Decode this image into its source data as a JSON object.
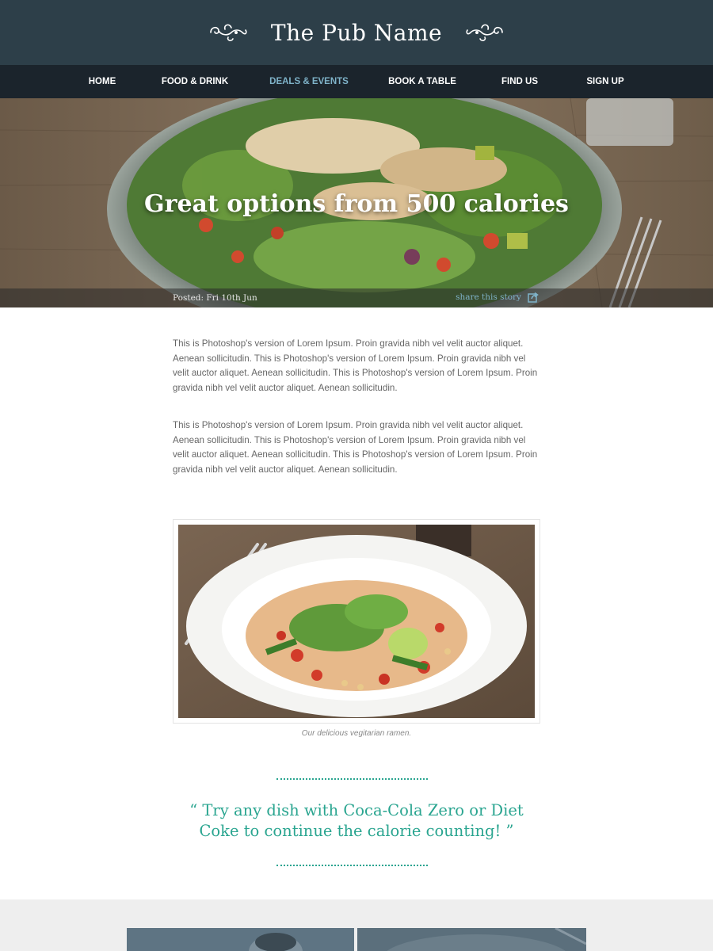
{
  "header": {
    "brand_title": "The Pub Name",
    "background_color": "#2d3f49",
    "flourish_icon": "ornament-scroll-icon"
  },
  "nav": {
    "background_color": "#1b242c",
    "items": [
      {
        "label": "HOME",
        "active": false
      },
      {
        "label": "FOOD & DRINK",
        "active": false
      },
      {
        "label": "DEALS & EVENTS",
        "active": true
      },
      {
        "label": "BOOK A TABLE",
        "active": false
      },
      {
        "label": "FIND US",
        "active": false
      },
      {
        "label": "SIGN UP",
        "active": false
      }
    ],
    "active_color": "#7fb3c9"
  },
  "hero": {
    "title": "Great options from 500 calories",
    "posted": "Posted: Fri 10th Jun",
    "share_label": "share this story",
    "share_icon": "share-arrow-icon"
  },
  "article": {
    "paragraphs": [
      "This is Photoshop's version  of Lorem Ipsum. Proin gravida nibh vel velit auctor aliquet. Aenean sollicitudin. This is Photoshop's version  of Lorem Ipsum. Proin gravida nibh vel velit auctor aliquet. Aenean sollicitudin. This is Photoshop's version  of Lorem Ipsum. Proin gravida nibh vel velit auctor aliquet. Aenean sollicitudin.",
      "This is Photoshop's version  of Lorem Ipsum. Proin gravida nibh vel velit auctor aliquet. Aenean sollicitudin. This is Photoshop's version  of Lorem Ipsum. Proin gravida nibh vel velit auctor aliquet. Aenean sollicitudin. This is Photoshop's version  of Lorem Ipsum. Proin gravida nibh vel velit auctor aliquet. Aenean sollicitudin."
    ],
    "figure_caption": "Our delicious vegitarian ramen."
  },
  "quote": {
    "line1": "“ Try any dish with Coca-Cola Zero or Diet",
    "line2": "Coke to continue the calorie counting! ”",
    "accent_color": "#2aa590"
  }
}
